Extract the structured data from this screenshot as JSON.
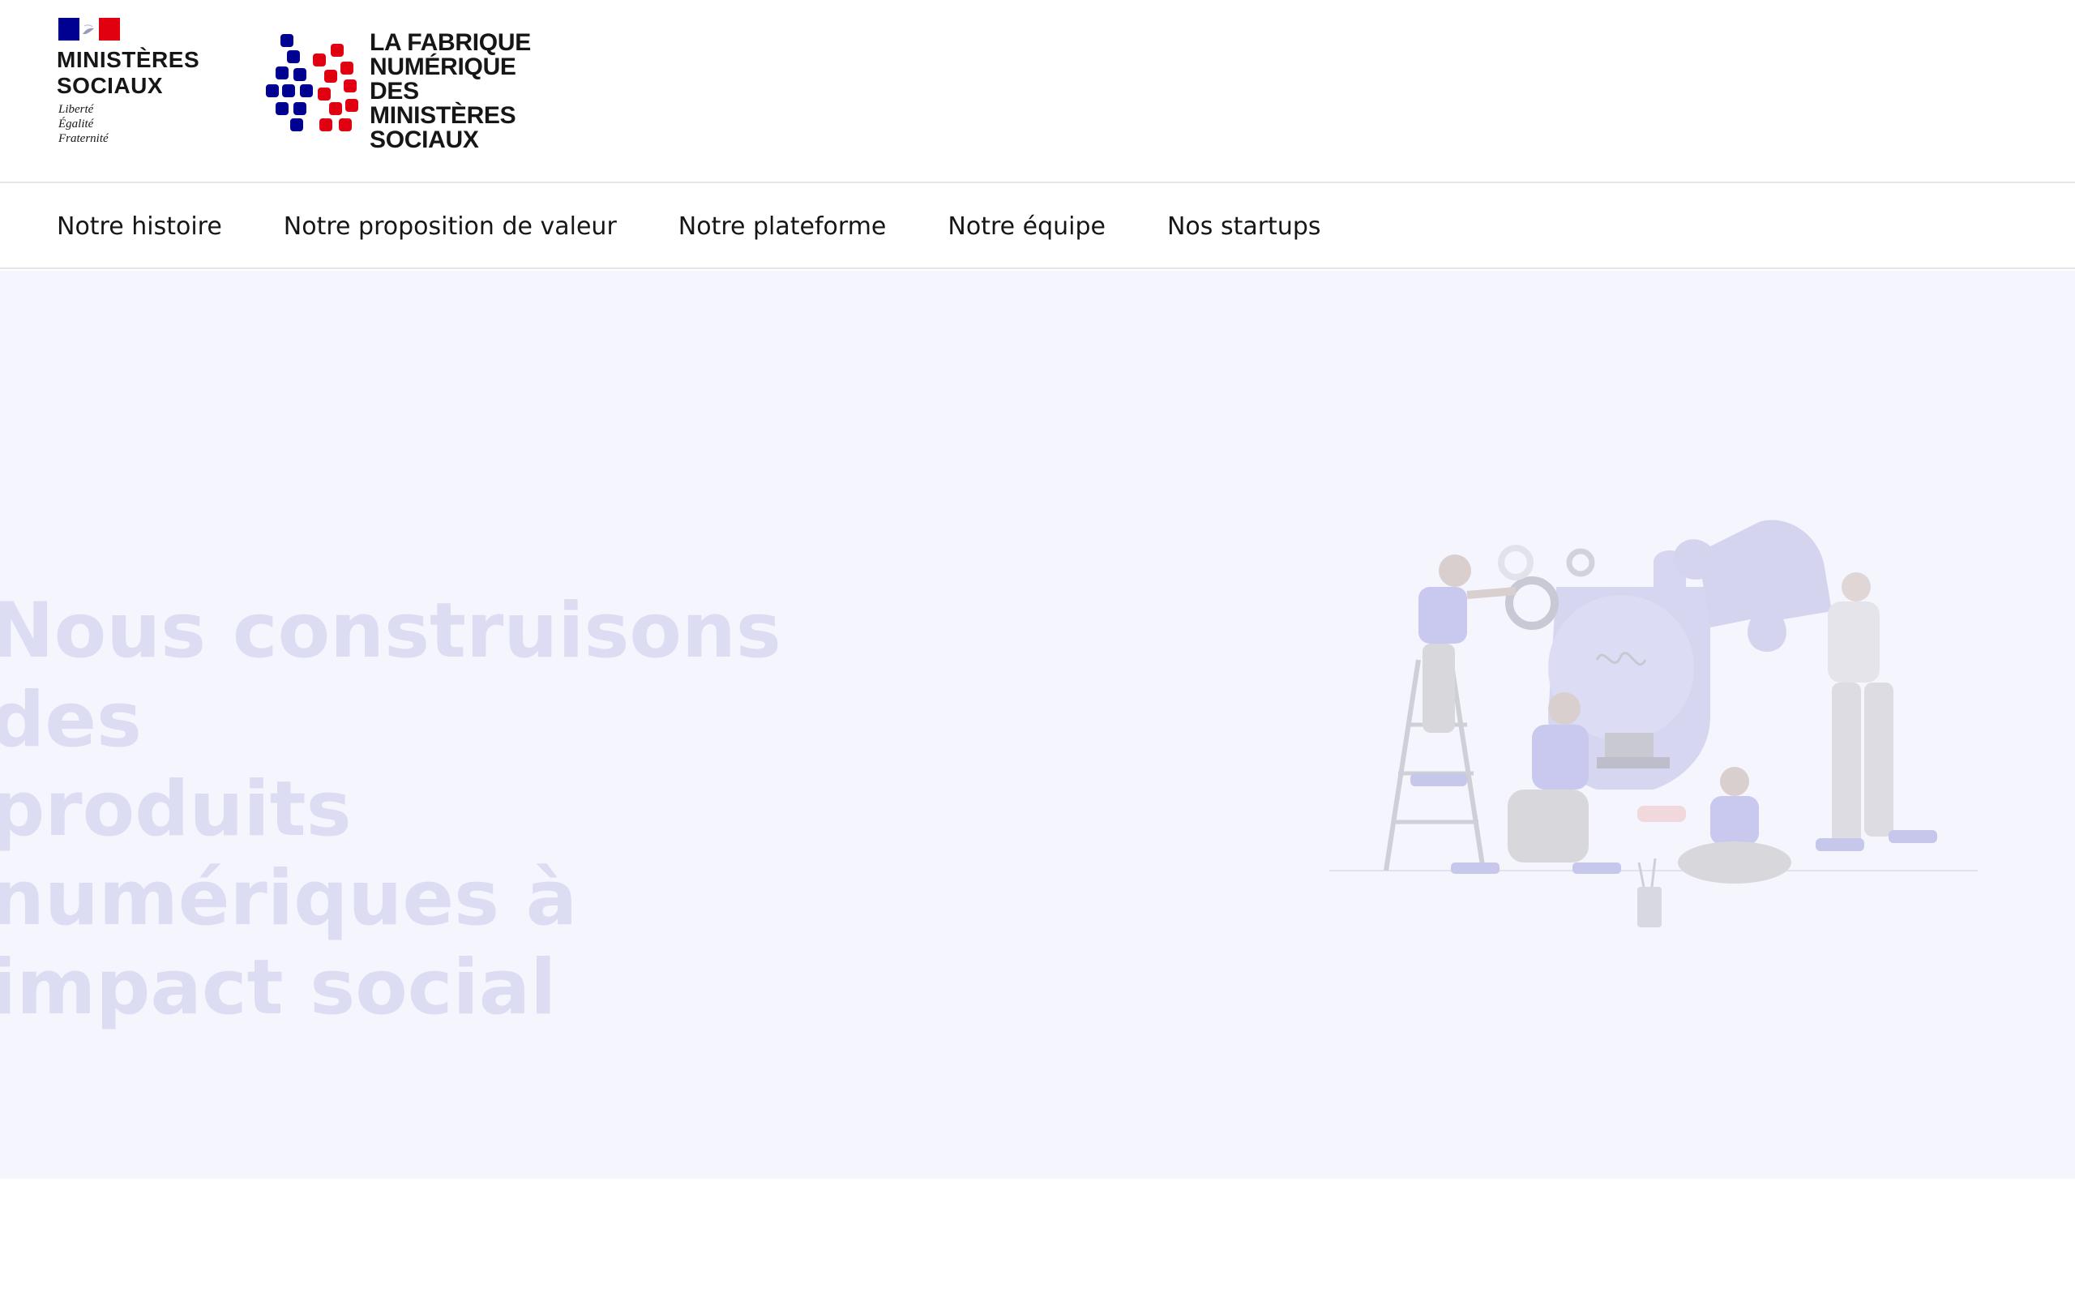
{
  "header": {
    "gov_logo": {
      "title": "MINISTÈRES\nSOCIAUX",
      "motto": "Liberté\nÉgalité\nFraternité",
      "colors": {
        "blue": "#000091",
        "red": "#e1000f"
      }
    },
    "fabrique_logo": {
      "title": "LA FABRIQUE\nNUMÉRIQUE\nDES MINISTÈRES\nSOCIAUX",
      "colors": {
        "blue": "#000091",
        "red": "#e1000f"
      }
    }
  },
  "nav": {
    "items": [
      {
        "label": "Notre histoire"
      },
      {
        "label": "Notre proposition de valeur"
      },
      {
        "label": "Notre plateforme"
      },
      {
        "label": "Notre équipe"
      },
      {
        "label": "Nos startups"
      }
    ]
  },
  "hero": {
    "title": "Nous construisons des\nproduits numériques à\nimpact social",
    "illustration": "team-building-puzzle-illustration",
    "colors": {
      "background": "#f5f5fe",
      "title": "#dcdcf2"
    }
  }
}
